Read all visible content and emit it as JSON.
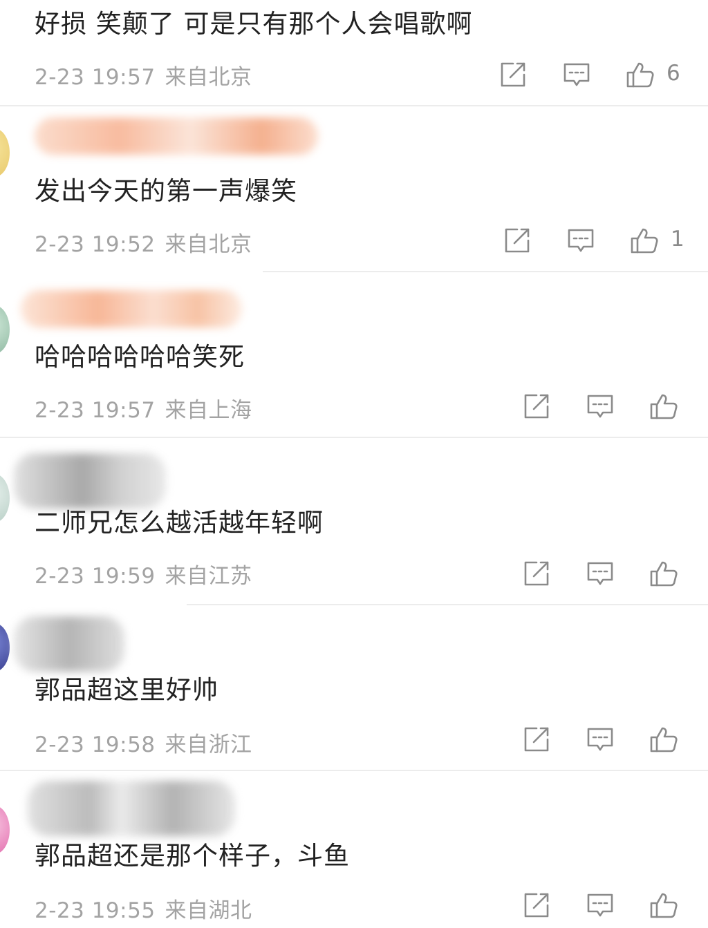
{
  "comments": [
    {
      "text": "好损 笑颠了 可是只有那个人会唱歌啊",
      "time": "2-23 19:57",
      "location": "来自北京",
      "likes": "6",
      "username_fragment": ""
    },
    {
      "text": "发出今天的第一声爆笑",
      "time": "2-23 19:52",
      "location": "来自北京",
      "likes": "1",
      "username_fragment": ""
    },
    {
      "text": "哈哈哈哈哈哈笑死",
      "time": "2-23 19:57",
      "location": "来自上海",
      "likes": "",
      "username_fragment": ""
    },
    {
      "text": "二师兄怎么越活越年轻啊",
      "time": "2-23 19:59",
      "location": "来自江苏",
      "likes": "",
      "username_fragment": ""
    },
    {
      "text": "郭品超这里好帅",
      "time": "2-23 19:58",
      "location": "来自浙江",
      "likes": "",
      "username_fragment": ""
    },
    {
      "text": "郭品超还是那个样子，斗鱼",
      "time": "2-23 19:55",
      "location": "来自湖北",
      "likes": "",
      "username_fragment": ""
    }
  ],
  "icons": {
    "share": "share-icon",
    "comment": "comment-icon",
    "like": "thumbs-up-icon"
  },
  "colors": {
    "text": "#222222",
    "meta": "#a3a3a3",
    "icon": "#8a8a8a",
    "divider": "#ececec"
  }
}
